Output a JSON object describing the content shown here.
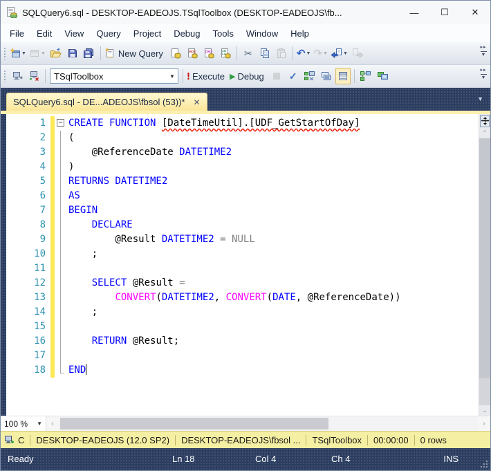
{
  "window": {
    "title": "SQLQuery6.sql - DESKTOP-EADEOJS.TSqlToolbox (DESKTOP-EADEOJS\\fb...",
    "controls": {
      "minimize": "—",
      "maximize": "☐",
      "close": "✕"
    }
  },
  "menu": {
    "items": [
      "File",
      "Edit",
      "View",
      "Query",
      "Project",
      "Debug",
      "Tools",
      "Window",
      "Help"
    ]
  },
  "toolbar_standard": {
    "new_query_label": "New Query"
  },
  "toolbar_sql": {
    "database_combo_value": "TSqlToolbox",
    "execute_label": "Execute",
    "debug_label": "Debug"
  },
  "tab": {
    "label": "SQLQuery6.sql - DE...ADEOJS\\fbsol (53))*",
    "close_glyph": "✕"
  },
  "icons": {
    "fold-collapse-glyph": "−",
    "dropdown-glyph": "▼",
    "scroll-up-glyph": "⌃",
    "scroll-down-glyph": "⌄",
    "scroll-left-glyph": "‹",
    "scroll-right-glyph": "›",
    "cut-glyph": "✂",
    "undo-glyph": "↶",
    "redo-glyph": "↷",
    "parse-glyph": "✓",
    "debug-play-glyph": "▶",
    "execute-glyph": "!"
  },
  "editor": {
    "lines": [
      {
        "n": "1",
        "fold": "box",
        "seg": [
          [
            "CREATE FUNCTION ",
            "kw"
          ],
          [
            "[DateTimeUtil].[UDF_GetStartOfDay]",
            "er"
          ]
        ]
      },
      {
        "n": "2",
        "fold": "line",
        "seg": [
          [
            "(",
            "pl"
          ]
        ]
      },
      {
        "n": "3",
        "fold": "line",
        "seg": [
          [
            "    @ReferenceDate ",
            "pl"
          ],
          [
            "DATETIME2",
            "kw"
          ]
        ]
      },
      {
        "n": "4",
        "fold": "line",
        "seg": [
          [
            ")",
            "pl"
          ]
        ]
      },
      {
        "n": "5",
        "fold": "line",
        "seg": [
          [
            "RETURNS DATETIME2",
            "kw"
          ]
        ]
      },
      {
        "n": "6",
        "fold": "line",
        "seg": [
          [
            "AS",
            "kw"
          ]
        ]
      },
      {
        "n": "7",
        "fold": "line",
        "seg": [
          [
            "BEGIN",
            "kw"
          ]
        ]
      },
      {
        "n": "8",
        "fold": "line",
        "seg": [
          [
            "    ",
            "pl"
          ],
          [
            "DECLARE",
            "kw"
          ]
        ]
      },
      {
        "n": "9",
        "fold": "line",
        "seg": [
          [
            "        @Result ",
            "pl"
          ],
          [
            "DATETIME2",
            "kw"
          ],
          [
            " ",
            "pl"
          ],
          [
            "=",
            "gy"
          ],
          [
            " ",
            "pl"
          ],
          [
            "NULL",
            "gy"
          ]
        ]
      },
      {
        "n": "10",
        "fold": "line",
        "seg": [
          [
            "    ;",
            "pl"
          ]
        ]
      },
      {
        "n": "11",
        "fold": "line",
        "seg": []
      },
      {
        "n": "12",
        "fold": "line",
        "seg": [
          [
            "    ",
            "pl"
          ],
          [
            "SELECT",
            "kw"
          ],
          [
            " @Result ",
            "pl"
          ],
          [
            "=",
            "gy"
          ]
        ]
      },
      {
        "n": "13",
        "fold": "line",
        "seg": [
          [
            "        ",
            "pl"
          ],
          [
            "CONVERT",
            "fn"
          ],
          [
            "(",
            "pl"
          ],
          [
            "DATETIME2",
            "kw"
          ],
          [
            ", ",
            "pl"
          ],
          [
            "CONVERT",
            "fn"
          ],
          [
            "(",
            "pl"
          ],
          [
            "DATE",
            "kw"
          ],
          [
            ", @ReferenceDate))",
            "pl"
          ]
        ]
      },
      {
        "n": "14",
        "fold": "line",
        "seg": [
          [
            "    ;",
            "pl"
          ]
        ]
      },
      {
        "n": "15",
        "fold": "line",
        "seg": []
      },
      {
        "n": "16",
        "fold": "line",
        "seg": [
          [
            "    ",
            "pl"
          ],
          [
            "RETURN",
            "kw"
          ],
          [
            " @Result;",
            "pl"
          ]
        ]
      },
      {
        "n": "17",
        "fold": "line",
        "seg": []
      },
      {
        "n": "18",
        "fold": "end",
        "seg": [
          [
            "END",
            "kw"
          ]
        ],
        "caret": true
      }
    ]
  },
  "zoom_control": {
    "value": "100 %"
  },
  "connection_bar": {
    "status_abbrev": "C",
    "items": [
      "DESKTOP-EADEOJS (12.0 SP2)",
      "DESKTOP-EADEOJS\\fbsol ...",
      "TSqlToolbox",
      "00:00:00",
      "0 rows"
    ]
  },
  "status_bar": {
    "state": "Ready",
    "line": "Ln 18",
    "col": "Col 4",
    "ch": "Ch 4",
    "mode": "INS"
  },
  "colors": {
    "keyword": "#0000FF",
    "system_function": "#FF00FF",
    "operator_gray": "#808080",
    "line_number": "#2B91AF",
    "squiggle": "#E51400",
    "change_bar": "#FDE856",
    "active_tab": "#FBE698",
    "shell_navy": "#2C3D5F",
    "connection_bar_yellow": "#F5EFA3"
  }
}
